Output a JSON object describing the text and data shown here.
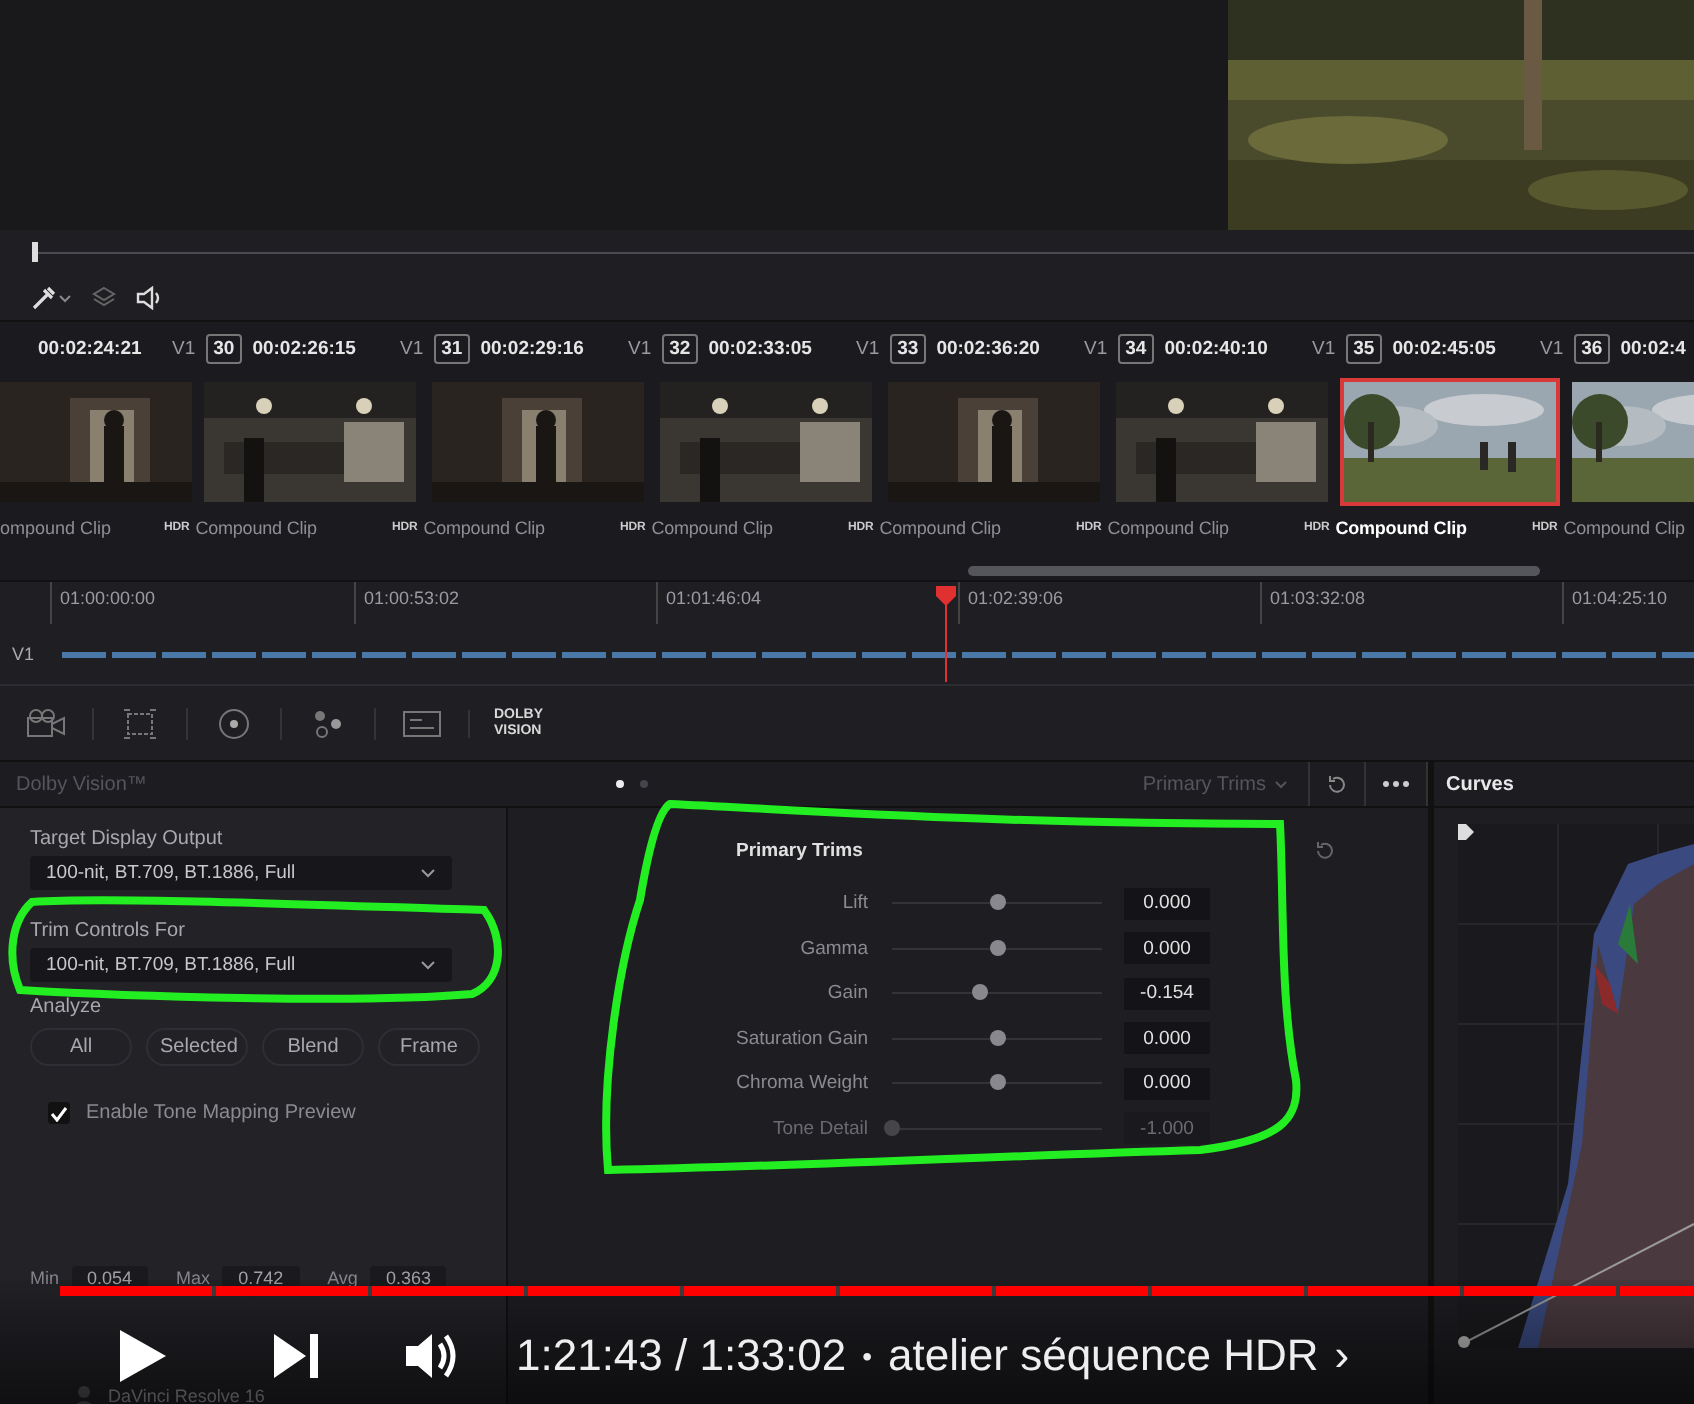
{
  "clips": [
    {
      "timecode": "00:02:24:21",
      "label": "ompound Clip",
      "selected": false
    },
    {
      "track": "V1",
      "number": "30",
      "timecode": "00:02:26:15",
      "hdr_badge": "HDR",
      "label": "Compound Clip",
      "selected": false
    },
    {
      "track": "V1",
      "number": "31",
      "timecode": "00:02:29:16",
      "hdr_badge": "HDR",
      "label": "Compound Clip",
      "selected": false
    },
    {
      "track": "V1",
      "number": "32",
      "timecode": "00:02:33:05",
      "hdr_badge": "HDR",
      "label": "Compound Clip",
      "selected": false
    },
    {
      "track": "V1",
      "number": "33",
      "timecode": "00:02:36:20",
      "hdr_badge": "HDR",
      "label": "Compound Clip",
      "selected": false
    },
    {
      "track": "V1",
      "number": "34",
      "timecode": "00:02:40:10",
      "hdr_badge": "HDR",
      "label": "Compound Clip",
      "selected": false
    },
    {
      "track": "V1",
      "number": "35",
      "timecode": "00:02:45:05",
      "hdr_badge": "HDR",
      "label": "Compound Clip",
      "selected": true
    },
    {
      "track": "V1",
      "number": "36",
      "timecode": "00:02:4",
      "hdr_badge": "HDR",
      "label": "Compound Clip",
      "selected": false
    }
  ],
  "ruler": {
    "ticks": [
      "01:00:00:00",
      "01:00:53:02",
      "01:01:46:04",
      "01:02:39:06",
      "01:03:32:08",
      "01:04:25:10"
    ],
    "track_label": "V1"
  },
  "palette": {
    "dolby_lines": [
      "DOLBY",
      "VISION"
    ]
  },
  "panel": {
    "title": "Dolby Vision™",
    "pages": [
      {
        "selected": true
      },
      {
        "selected": false
      }
    ],
    "mode": "Primary Trims"
  },
  "settings": {
    "target_label": "Target Display Output",
    "target_value": "100-nit, BT.709, BT.1886, Full",
    "trim_label": "Trim Controls For",
    "trim_value": "100-nit, BT.709, BT.1886, Full",
    "analyze_label": "Analyze",
    "analyze_buttons": [
      "All",
      "Selected",
      "Blend",
      "Frame"
    ],
    "tone_mapping": {
      "label": "Enable Tone Mapping Preview",
      "checked": true
    },
    "stats": [
      {
        "label": "Min",
        "value": "0.054"
      },
      {
        "label": "Max",
        "value": "0.742"
      },
      {
        "label": "Avg",
        "value": "0.363"
      }
    ]
  },
  "trims": {
    "title": "Primary Trims",
    "controls": [
      {
        "label": "Lift",
        "level": 0.5,
        "value": "0.000",
        "disabled": false
      },
      {
        "label": "Gamma",
        "level": 0.5,
        "value": "0.000",
        "disabled": false
      },
      {
        "label": "Gain",
        "level": 0.42,
        "value": "-0.154",
        "disabled": false
      },
      {
        "label": "Saturation Gain",
        "level": 0.5,
        "value": "0.000",
        "disabled": false
      },
      {
        "label": "Chroma Weight",
        "level": 0.5,
        "value": "0.000",
        "disabled": false
      },
      {
        "label": "Tone Detail",
        "level": 0,
        "value": "-1.000",
        "disabled": true
      }
    ]
  },
  "curves": {
    "title": "Curves"
  },
  "player": {
    "progress": {
      "level": 1
    },
    "time": "1:21:43 / 1:33:02",
    "separator": "•",
    "chapter": "atelier séquence HDR",
    "chevron": "›"
  },
  "taskbar": {
    "app_name": "DaVinci Resolve 16"
  }
}
